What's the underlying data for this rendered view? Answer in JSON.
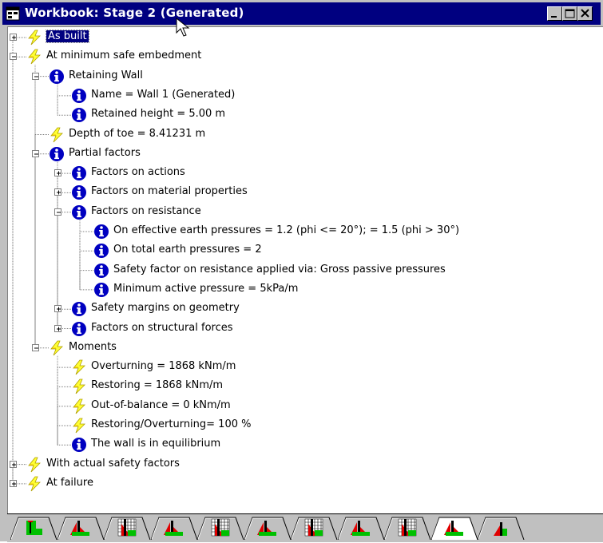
{
  "window": {
    "title": "Workbook: Stage 2 (Generated)",
    "icons": {
      "app": "workbook-icon",
      "minimize": "minimize-icon",
      "maximize": "maximize-icon",
      "close": "close-icon"
    }
  },
  "colors": {
    "titlebar": "#000080",
    "info_blue": "#0000c0",
    "bolt_yellow": "#ffff33",
    "tab_green": "#00c000",
    "tab_red": "#e00000"
  },
  "tree": [
    {
      "id": "as-built",
      "label": "As built",
      "icon": "bolt-icon",
      "toggle": "plus",
      "selected": true
    },
    {
      "id": "at-minimum-safe-embedment",
      "label": "At minimum safe embedment",
      "icon": "bolt-icon",
      "toggle": "minus"
    },
    {
      "id": "retaining-wall",
      "label": "Retaining Wall",
      "icon": "info-icon",
      "toggle": "minus"
    },
    {
      "id": "wall-name",
      "label": "Name = Wall 1 (Generated)",
      "icon": "info-icon"
    },
    {
      "id": "retained-height",
      "label": "Retained height = 5.00 m",
      "icon": "info-icon"
    },
    {
      "id": "depth-of-toe",
      "label": "Depth of toe = 8.41231 m",
      "icon": "bolt-icon"
    },
    {
      "id": "partial-factors",
      "label": "Partial factors",
      "icon": "info-icon",
      "toggle": "minus"
    },
    {
      "id": "factors-on-actions",
      "label": "Factors on actions",
      "icon": "info-icon",
      "toggle": "plus"
    },
    {
      "id": "factors-on-material-properties",
      "label": "Factors on material properties",
      "icon": "info-icon",
      "toggle": "plus"
    },
    {
      "id": "factors-on-resistance",
      "label": "Factors on resistance",
      "icon": "info-icon",
      "toggle": "minus"
    },
    {
      "id": "effective-earth-pressures",
      "label": "On effective earth pressures = 1.2 (phi <= 20°); = 1.5 (phi > 30°)",
      "icon": "info-icon"
    },
    {
      "id": "total-earth-pressures",
      "label": "On total earth pressures = 2",
      "icon": "info-icon"
    },
    {
      "id": "safety-factor-applied",
      "label": "Safety factor on resistance applied via: Gross passive pressures",
      "icon": "info-icon"
    },
    {
      "id": "minimum-active-pressure",
      "label": "Minimum active pressure = 5kPa/m",
      "icon": "info-icon"
    },
    {
      "id": "safety-margins-on-geometry",
      "label": "Safety margins on geometry",
      "icon": "info-icon",
      "toggle": "plus"
    },
    {
      "id": "factors-on-structural-forces",
      "label": "Factors on structural forces",
      "icon": "info-icon",
      "toggle": "plus"
    },
    {
      "id": "moments",
      "label": "Moments",
      "icon": "bolt-icon",
      "toggle": "minus"
    },
    {
      "id": "overturning",
      "label": "Overturning = 1868 kNm/m",
      "icon": "bolt-icon"
    },
    {
      "id": "restoring",
      "label": "Restoring = 1868 kNm/m",
      "icon": "bolt-icon"
    },
    {
      "id": "out-of-balance",
      "label": "Out-of-balance = 0 kNm/m",
      "icon": "bolt-icon"
    },
    {
      "id": "restoring-overturning",
      "label": "Restoring/Overturning= 100 %",
      "icon": "bolt-icon"
    },
    {
      "id": "wall-in-equilibrium",
      "label": "The wall is in equilibrium",
      "icon": "info-icon"
    },
    {
      "id": "with-actual-safety-factors",
      "label": "With actual safety factors",
      "icon": "bolt-icon",
      "toggle": "plus"
    },
    {
      "id": "at-failure",
      "label": "At failure",
      "icon": "bolt-icon",
      "toggle": "plus"
    }
  ],
  "tabs": [
    {
      "id": "stage-1",
      "icon": "wall-stage-icon"
    },
    {
      "id": "stage-2",
      "icon": "pressure-diagram-icon"
    },
    {
      "id": "stage-3",
      "icon": "grid-pressure-icon"
    },
    {
      "id": "stage-4",
      "icon": "pressure-diagram-icon"
    },
    {
      "id": "stage-5",
      "icon": "grid-pressure-icon"
    },
    {
      "id": "stage-6",
      "icon": "pressure-diagram-icon"
    },
    {
      "id": "stage-7",
      "icon": "grid-pressure-icon"
    },
    {
      "id": "stage-8",
      "icon": "pressure-diagram-icon"
    },
    {
      "id": "stage-9",
      "icon": "grid-pressure-icon"
    },
    {
      "id": "stage-10",
      "icon": "pressure-diagram-icon",
      "active": true
    },
    {
      "id": "stage-11",
      "icon": "pressure-partial-icon"
    }
  ]
}
